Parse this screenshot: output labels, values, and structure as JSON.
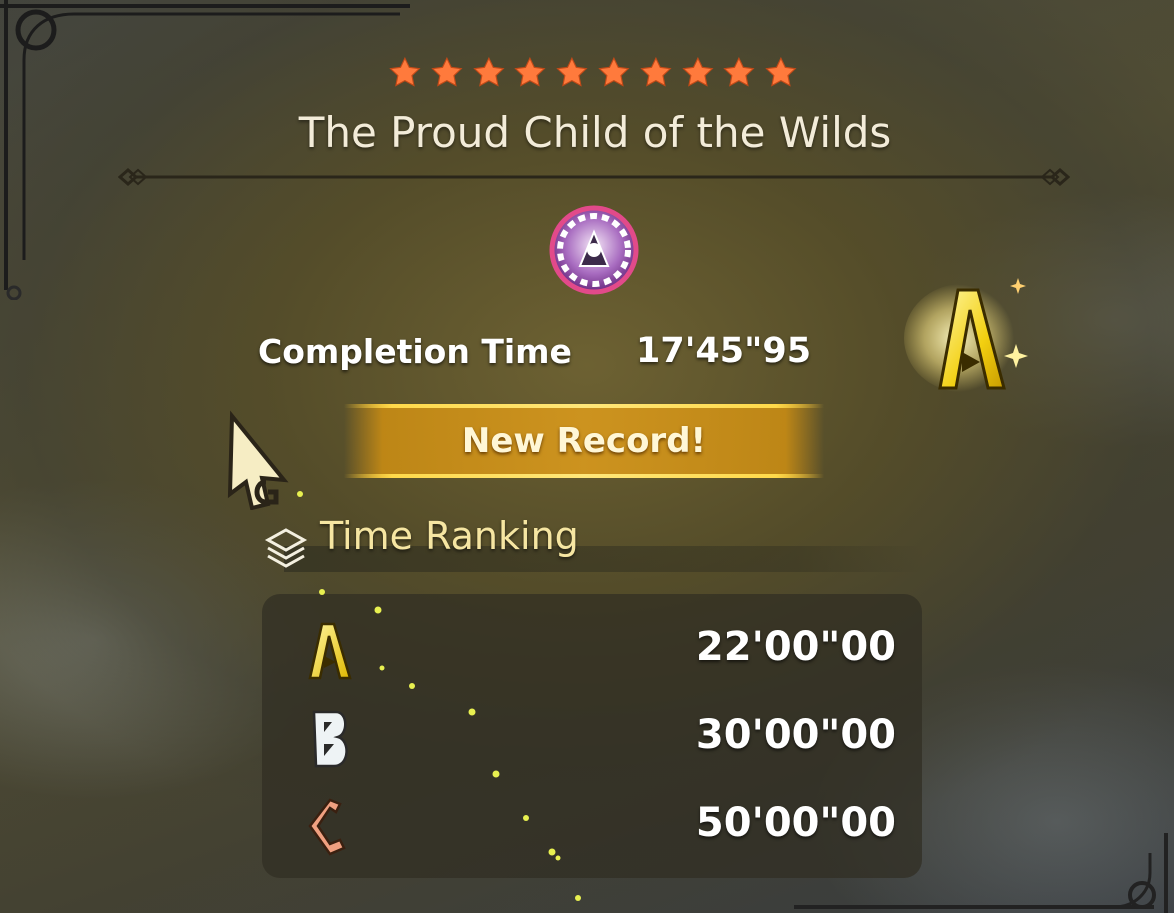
{
  "quest": {
    "star_count": 10,
    "star_color": "#ff7a3c",
    "title": "The Proud Child of the Wilds"
  },
  "result": {
    "completion_label": "Completion Time",
    "completion_time": "17'45\"95",
    "earned_rank": "A",
    "new_record_label": "New Record!"
  },
  "ranking": {
    "header": "Time Ranking",
    "rows": [
      {
        "rank": "A",
        "time": "22'00\"00",
        "color": "#e8d020"
      },
      {
        "rank": "B",
        "time": "30'00\"00",
        "color": "#e8eef2"
      },
      {
        "rank": "C",
        "time": "50'00\"00",
        "color": "#e8967a"
      }
    ]
  },
  "colors": {
    "title_text": "#f3ecd9",
    "accent_gold": "#ffd94a",
    "header_text": "#f6e6a2"
  },
  "icons": [
    "star-icon",
    "monster-emblem-icon",
    "rank-a-badge-icon",
    "cursor-icon",
    "time-ranking-icon",
    "rank-a-icon",
    "rank-b-icon",
    "rank-c-icon"
  ]
}
